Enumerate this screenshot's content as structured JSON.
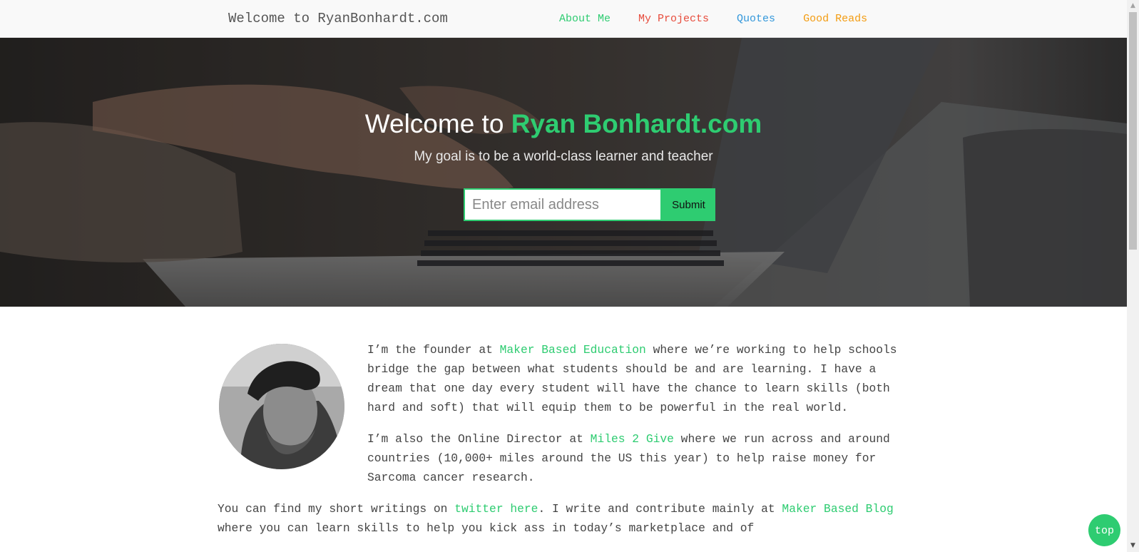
{
  "nav": {
    "brand": "Welcome to RyanBonhardt.com",
    "links": [
      {
        "label": "About Me",
        "color": "#2ecc71"
      },
      {
        "label": "My Projects",
        "color": "#e74c3c"
      },
      {
        "label": "Quotes",
        "color": "#3498db"
      },
      {
        "label": "Good Reads",
        "color": "#f39c12"
      }
    ]
  },
  "hero": {
    "title_prefix": "Welcome to",
    "title_highlight": "Ryan Bonhardt.com",
    "subtitle": "My goal is to be a world-class learner and teacher",
    "email_placeholder": "Enter email address",
    "submit_label": "Submit"
  },
  "content": {
    "p1": {
      "before": "I’m the founder at ",
      "link": "Maker Based Education",
      "after": " where we’re working to help schools bridge the gap between what students should be and are learning. I have a dream that one day every student will have the chance to learn skills (both hard and soft) that will equip them to be powerful in the real world."
    },
    "p2": {
      "before": "I’m also the Online Director at ",
      "link": "Miles 2 Give",
      "after": " where we run across and around countries (10,000+ miles around the US this year) to help raise money for Sarcoma cancer research."
    },
    "p3": {
      "before": "You can find my short writings on ",
      "link1": "twitter here",
      "middle": ". I write and contribute mainly at ",
      "link2": "Maker Based Blog",
      "after": " where you can learn skills to help you kick ass in today’s marketplace and of"
    }
  },
  "top_button": "top",
  "colors": {
    "accent": "#2ecc71"
  }
}
